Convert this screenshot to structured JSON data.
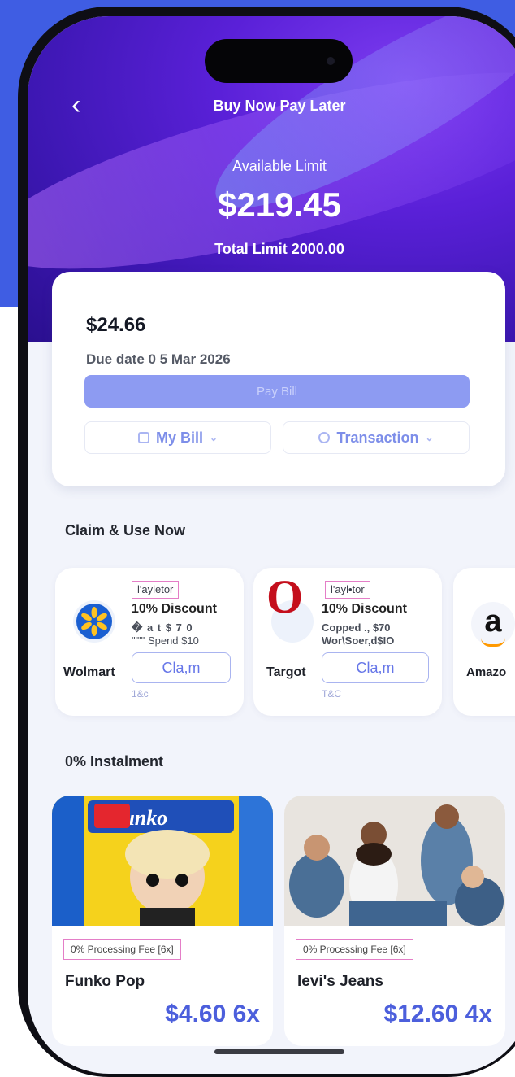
{
  "header": {
    "title": "Buy Now Pay Later",
    "available_label": "Available Limit",
    "available_amount": "$219.45",
    "total_limit": "Total Limit 2000.00"
  },
  "bill": {
    "amount": "$24.66",
    "due_date": "Due date 0 5 Mar 2026",
    "pay_button": "Pay Bill",
    "my_bill": "My Bill",
    "transaction": "Transaction"
  },
  "claim_section": {
    "title": "Claim & Use Now",
    "offers": [
      {
        "brand": "Wolmart",
        "tag": "l'ayletor",
        "discount": "10% Discount",
        "line1": "� a t $ 7 0",
        "line2": "\"\"\"' Spend $10",
        "claim": "Cla,m",
        "tnc": "1&c"
      },
      {
        "brand": "Targot",
        "tag": "l'ayl•tor",
        "discount": "10% Discount",
        "line1": "Copped ., $70",
        "line2": "Wor\\Soer,d$IO",
        "claim": "Cla,m",
        "tnc": "T&C"
      },
      {
        "brand": "Amazo",
        "logo_letter": "a"
      }
    ]
  },
  "instalment_section": {
    "title": "0% Instalment",
    "products": [
      {
        "fee": "0% Processing Fee [6x]",
        "name": "Funko Pop",
        "price": "$4.60 6x"
      },
      {
        "fee": "0% Processing Fee [6x]",
        "name": "levi's Jeans",
        "price": "$12.60 4x"
      }
    ]
  },
  "colors": {
    "accent": "#4c5fdc",
    "header_purple": "#5a20d8",
    "background_blue": "#3f5de3"
  }
}
